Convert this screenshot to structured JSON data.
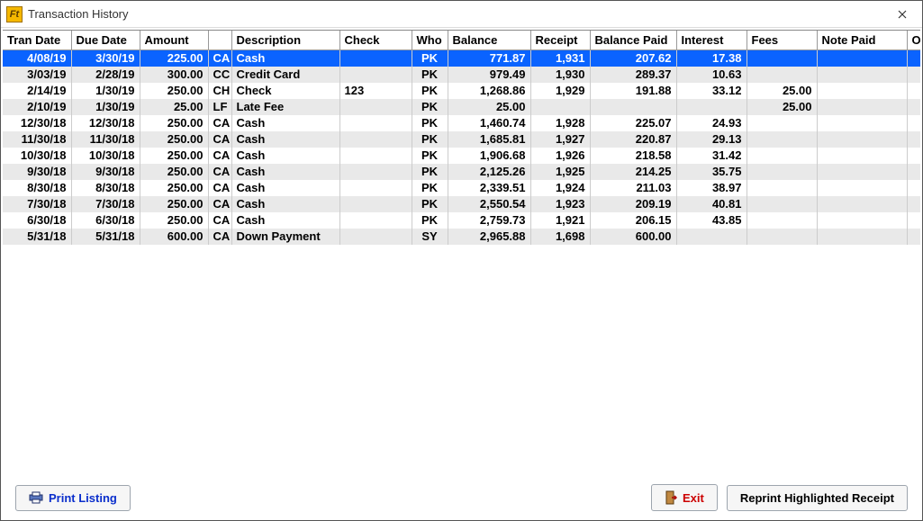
{
  "window": {
    "title": "Transaction History"
  },
  "columns": [
    {
      "key": "tran_date",
      "label": "Tran Date",
      "cls": "c-trandate",
      "align": "num"
    },
    {
      "key": "due_date",
      "label": "Due Date",
      "cls": "c-duedate",
      "align": "num"
    },
    {
      "key": "amount",
      "label": "Amount",
      "cls": "c-amount",
      "align": "num"
    },
    {
      "key": "type",
      "label": "",
      "cls": "c-type",
      "align": ""
    },
    {
      "key": "desc",
      "label": "Description",
      "cls": "c-desc",
      "align": ""
    },
    {
      "key": "check",
      "label": "Check",
      "cls": "c-check",
      "align": ""
    },
    {
      "key": "who",
      "label": "Who",
      "cls": "c-who",
      "align": "ctr"
    },
    {
      "key": "balance",
      "label": "Balance",
      "cls": "c-balance",
      "align": "num"
    },
    {
      "key": "receipt",
      "label": "Receipt",
      "cls": "c-receipt",
      "align": "num"
    },
    {
      "key": "bal_paid",
      "label": "Balance Paid",
      "cls": "c-bpaid",
      "align": "num"
    },
    {
      "key": "interest",
      "label": "Interest",
      "cls": "c-interest",
      "align": "num"
    },
    {
      "key": "fees",
      "label": "Fees",
      "cls": "c-fees",
      "align": "num"
    },
    {
      "key": "note_paid",
      "label": "Note Paid",
      "cls": "c-notepaid",
      "align": "num"
    },
    {
      "key": "ot",
      "label": "Ot",
      "cls": "c-ot",
      "align": "num"
    }
  ],
  "rows": [
    {
      "selected": true,
      "tran_date": "4/08/19",
      "due_date": "3/30/19",
      "amount": "225.00",
      "type": "CA",
      "desc": "Cash",
      "check": "",
      "who": "PK",
      "balance": "771.87",
      "receipt": "1,931",
      "bal_paid": "207.62",
      "interest": "17.38",
      "fees": "",
      "note_paid": "",
      "ot": ""
    },
    {
      "selected": false,
      "tran_date": "3/03/19",
      "due_date": "2/28/19",
      "amount": "300.00",
      "type": "CC",
      "desc": "Credit Card",
      "check": "",
      "who": "PK",
      "balance": "979.49",
      "receipt": "1,930",
      "bal_paid": "289.37",
      "interest": "10.63",
      "fees": "",
      "note_paid": "",
      "ot": ""
    },
    {
      "selected": false,
      "tran_date": "2/14/19",
      "due_date": "1/30/19",
      "amount": "250.00",
      "type": "CH",
      "desc": "Check",
      "check": "123",
      "who": "PK",
      "balance": "1,268.86",
      "receipt": "1,929",
      "bal_paid": "191.88",
      "interest": "33.12",
      "fees": "25.00",
      "note_paid": "",
      "ot": ""
    },
    {
      "selected": false,
      "tran_date": "2/10/19",
      "due_date": "1/30/19",
      "amount": "25.00",
      "type": "LF",
      "desc": "Late Fee",
      "check": "",
      "who": "PK",
      "balance": "25.00",
      "receipt": "",
      "bal_paid": "",
      "interest": "",
      "fees": "25.00",
      "note_paid": "",
      "ot": ""
    },
    {
      "selected": false,
      "tran_date": "12/30/18",
      "due_date": "12/30/18",
      "amount": "250.00",
      "type": "CA",
      "desc": "Cash",
      "check": "",
      "who": "PK",
      "balance": "1,460.74",
      "receipt": "1,928",
      "bal_paid": "225.07",
      "interest": "24.93",
      "fees": "",
      "note_paid": "",
      "ot": ""
    },
    {
      "selected": false,
      "tran_date": "11/30/18",
      "due_date": "11/30/18",
      "amount": "250.00",
      "type": "CA",
      "desc": "Cash",
      "check": "",
      "who": "PK",
      "balance": "1,685.81",
      "receipt": "1,927",
      "bal_paid": "220.87",
      "interest": "29.13",
      "fees": "",
      "note_paid": "",
      "ot": ""
    },
    {
      "selected": false,
      "tran_date": "10/30/18",
      "due_date": "10/30/18",
      "amount": "250.00",
      "type": "CA",
      "desc": "Cash",
      "check": "",
      "who": "PK",
      "balance": "1,906.68",
      "receipt": "1,926",
      "bal_paid": "218.58",
      "interest": "31.42",
      "fees": "",
      "note_paid": "",
      "ot": ""
    },
    {
      "selected": false,
      "tran_date": "9/30/18",
      "due_date": "9/30/18",
      "amount": "250.00",
      "type": "CA",
      "desc": "Cash",
      "check": "",
      "who": "PK",
      "balance": "2,125.26",
      "receipt": "1,925",
      "bal_paid": "214.25",
      "interest": "35.75",
      "fees": "",
      "note_paid": "",
      "ot": ""
    },
    {
      "selected": false,
      "tran_date": "8/30/18",
      "due_date": "8/30/18",
      "amount": "250.00",
      "type": "CA",
      "desc": "Cash",
      "check": "",
      "who": "PK",
      "balance": "2,339.51",
      "receipt": "1,924",
      "bal_paid": "211.03",
      "interest": "38.97",
      "fees": "",
      "note_paid": "",
      "ot": ""
    },
    {
      "selected": false,
      "tran_date": "7/30/18",
      "due_date": "7/30/18",
      "amount": "250.00",
      "type": "CA",
      "desc": "Cash",
      "check": "",
      "who": "PK",
      "balance": "2,550.54",
      "receipt": "1,923",
      "bal_paid": "209.19",
      "interest": "40.81",
      "fees": "",
      "note_paid": "",
      "ot": ""
    },
    {
      "selected": false,
      "tran_date": "6/30/18",
      "due_date": "6/30/18",
      "amount": "250.00",
      "type": "CA",
      "desc": "Cash",
      "check": "",
      "who": "PK",
      "balance": "2,759.73",
      "receipt": "1,921",
      "bal_paid": "206.15",
      "interest": "43.85",
      "fees": "",
      "note_paid": "",
      "ot": ""
    },
    {
      "selected": false,
      "tran_date": "5/31/18",
      "due_date": "5/31/18",
      "amount": "600.00",
      "type": "CA",
      "desc": "Down Payment",
      "check": "",
      "who": "SY",
      "balance": "2,965.88",
      "receipt": "1,698",
      "bal_paid": "600.00",
      "interest": "",
      "fees": "",
      "note_paid": "",
      "ot": ""
    }
  ],
  "buttons": {
    "print": "Print Listing",
    "exit": "Exit",
    "reprint": "Reprint Highlighted Receipt"
  }
}
